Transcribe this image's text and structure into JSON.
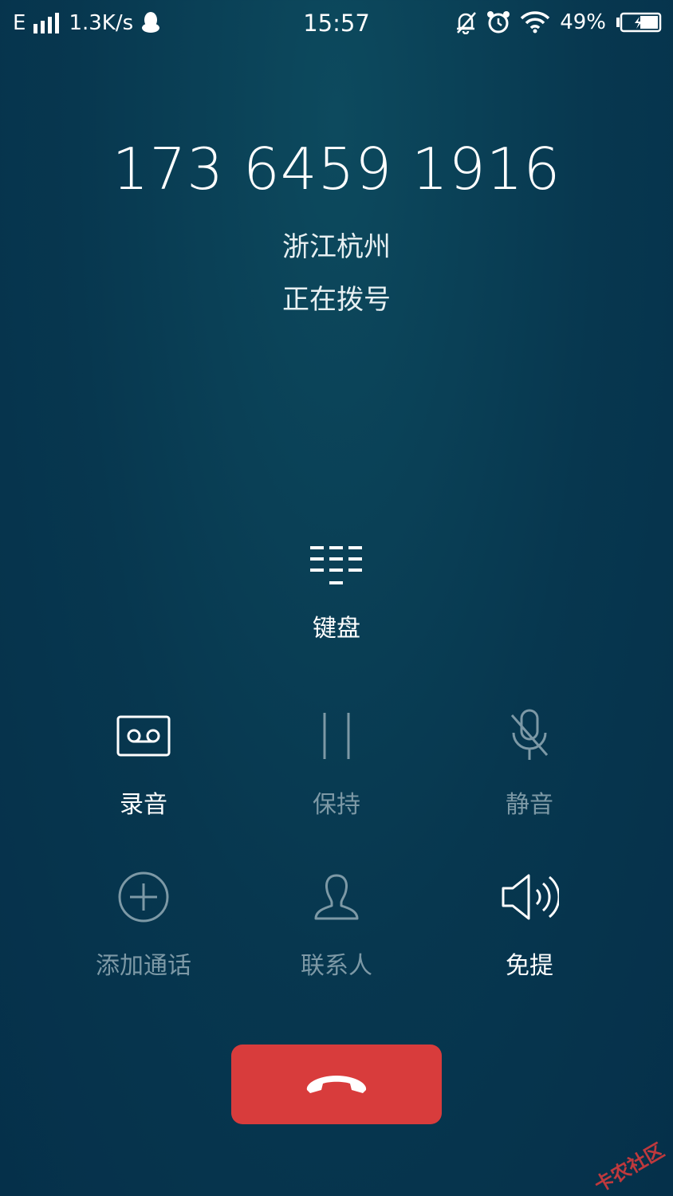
{
  "status_bar": {
    "network": "E",
    "speed": "1.3K/s",
    "time": "15:57",
    "battery": "49%"
  },
  "call": {
    "number": "173 6459 1916",
    "location": "浙江杭州",
    "status": "正在拨号"
  },
  "keypad": {
    "label": "键盘"
  },
  "controls": {
    "record": "录音",
    "hold": "保持",
    "mute": "静音",
    "add_call": "添加通话",
    "contacts": "联系人",
    "speaker": "免提"
  },
  "colors": {
    "background": "#07374f",
    "end_call": "#d83c3c",
    "dim_text": "#7d99a6"
  },
  "watermark": "卡农社区"
}
